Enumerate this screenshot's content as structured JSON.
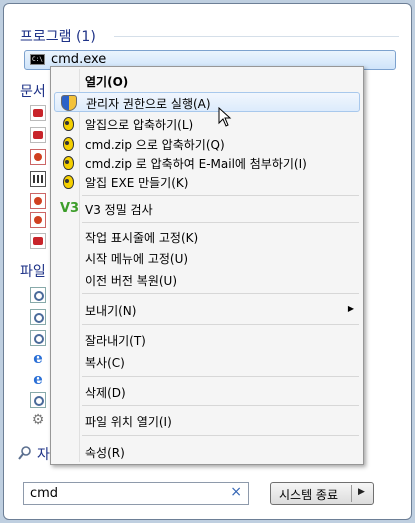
{
  "window": {
    "programs_header": "프로그램 (1)",
    "documents_header": "문서",
    "files_header": "파일",
    "search_more_label": "자"
  },
  "program_result": {
    "name": "cmd.exe",
    "icon": "C:\\"
  },
  "search": {
    "value": "cmd",
    "clear_glyph": "×"
  },
  "shutdown": {
    "label": "시스템 종료",
    "arrow": "▶"
  },
  "context_menu": {
    "open": "열기(O)",
    "run_as_admin": "관리자 권한으로 실행(A)",
    "alzip_compress": "알집으로 압축하기(L)",
    "compress_zip": "cmd.zip 으로 압축하기(Q)",
    "compress_email": "cmd.zip 로 압축하여 E-Mail에 첨부하기(I)",
    "alzip_exe": "알집 EXE 만들기(K)",
    "v3_scan": "V3 정밀 검사",
    "pin_taskbar": "작업 표시줄에 고정(K)",
    "pin_start": "시작 메뉴에 고정(U)",
    "restore_versions": "이전 버전 복원(U)",
    "send_to": "보내기(N)",
    "cut": "잘라내기(T)",
    "copy": "복사(C)",
    "delete": "삭제(D)",
    "open_location": "파일 위치 열기(I)",
    "properties": "속성(R)",
    "submenu_arrow": "▶",
    "v3_icon": "V3"
  },
  "icons": {
    "ie": "e",
    "gear": "⚙"
  }
}
